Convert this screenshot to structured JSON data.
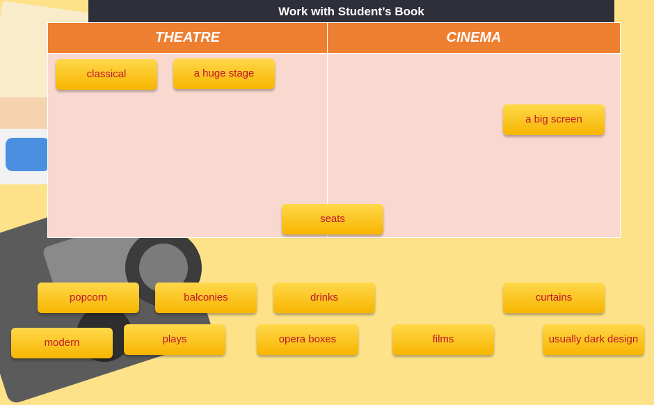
{
  "header": {
    "title": "Work with Student’s Book"
  },
  "table": {
    "left_heading": "THEATRE",
    "right_heading": "CINEMA"
  },
  "cards": {
    "classical": "classical",
    "a_huge_stage": "a huge stage",
    "a_big_screen": "a big screen",
    "seats": "seats",
    "popcorn": "popcorn",
    "balconies": "balconies",
    "drinks": "drinks",
    "curtains": "curtains",
    "modern": "modern",
    "plays": "plays",
    "opera_boxes": "opera boxes",
    "films": "films",
    "usually_dark_design": "usually dark design"
  },
  "colors": {
    "header_bg": "#2f2f3a",
    "column_heading_bg": "#ee7e30",
    "table_bg": "#f9d9cf",
    "card_bg": "#ffc21f",
    "card_text": "#c0142a",
    "page_bg": "#fde28a"
  }
}
